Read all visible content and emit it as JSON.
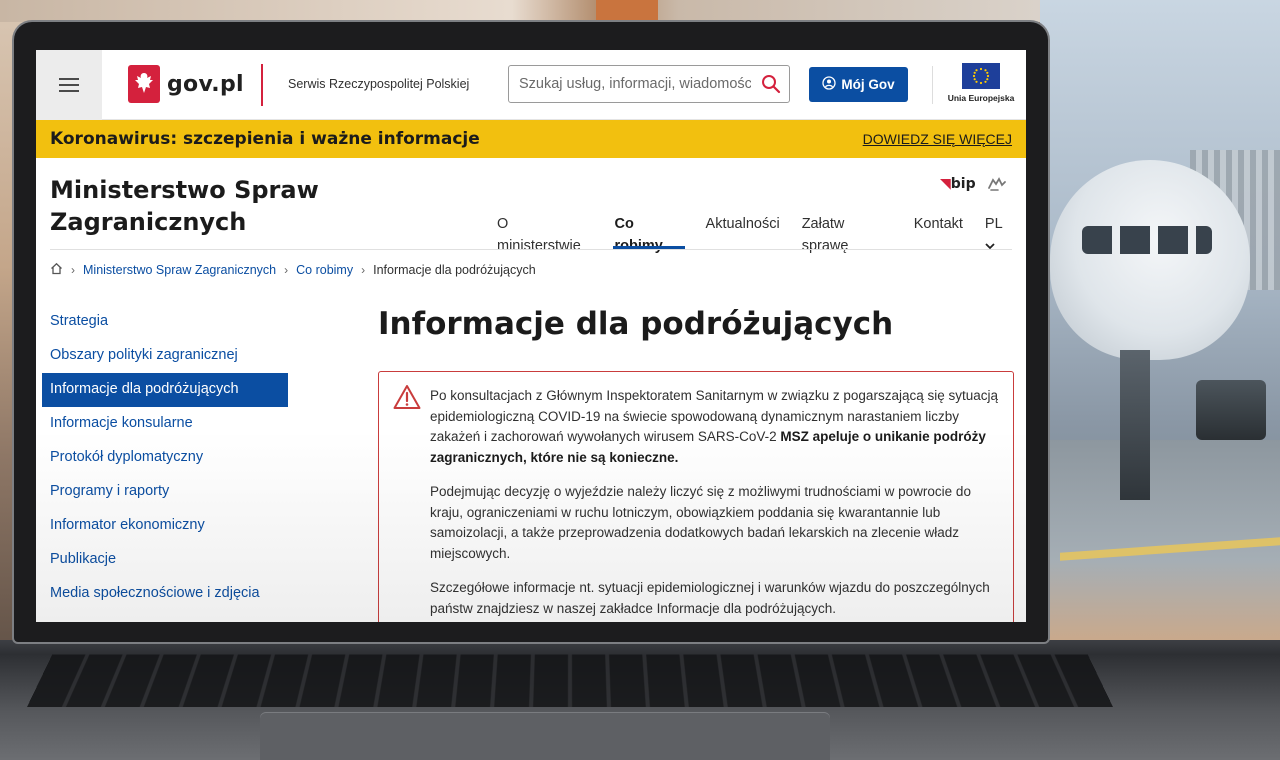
{
  "header": {
    "logo_text": "gov.pl",
    "service_name": "Serwis Rzeczypospolitej Polskiej",
    "search_placeholder": "Szukaj usług, informacji, wiadomości",
    "mojgov_label": "Mój Gov",
    "eu_label": "Unia Europejska"
  },
  "banner": {
    "title": "Koronawirus: szczepienia i ważne informacje",
    "link": "DOWIEDZ SIĘ WIĘCEJ"
  },
  "ministry": {
    "line1": "Ministerstwo Spraw",
    "line2": "Zagranicznych",
    "bip_label": "bip"
  },
  "nav": {
    "items": [
      {
        "label": "O ministerstwie"
      },
      {
        "label": "Co robimy"
      },
      {
        "label": "Aktualności"
      },
      {
        "label": "Załatw sprawę"
      },
      {
        "label": "Kontakt"
      },
      {
        "label": "PL"
      }
    ],
    "active": "Co robimy"
  },
  "breadcrumb": {
    "items": [
      "Ministerstwo Spraw Zagranicznych",
      "Co robimy"
    ],
    "current": "Informacje dla podróżujących"
  },
  "sidebar": {
    "items": [
      {
        "label": "Strategia"
      },
      {
        "label": "Obszary polityki zagranicznej"
      },
      {
        "label": "Informacje dla podróżujących"
      },
      {
        "label": "Informacje konsularne"
      },
      {
        "label": "Protokół dyplomatyczny"
      },
      {
        "label": "Programy i raporty"
      },
      {
        "label": "Informator ekonomiczny"
      },
      {
        "label": "Publikacje"
      },
      {
        "label": "Media społecznościowe i zdjęcia"
      }
    ],
    "active": "Informacje dla podróżujących"
  },
  "main": {
    "title": "Informacje dla podróżujących",
    "alert": {
      "p1_text": "Po konsultacjach z Głównym Inspektoratem Sanitarnym w związku z pogarszającą się sytuacją epidemiologiczną COVID-19 na świecie spowodowaną dynamicznym narastaniem liczby zakażeń i zachorowań wywołanych wirusem SARS-CoV-2 ",
      "p1_bold": "MSZ apeluje o unikanie podróży zagranicznych, które nie są konieczne.",
      "p2": "Podejmując decyzję o wyjeździe należy liczyć się z możliwymi trudnościami w powrocie do kraju, ograniczeniami w ruchu lotniczym, obowiązkiem poddania się kwarantannie lub samoizolacji, a także przeprowadzenia dodatkowych badań lekarskich na zlecenie władz miejscowych.",
      "p3": "Szczegółowe informacje nt. sytuacji epidemiologicznej i warunków wjazdu do poszczególnych państw znajdziesz w naszej zakładce Informacje dla podróżujących."
    }
  },
  "colors": {
    "gov_blue": "#0b4ea2",
    "banner_yellow": "#f2c00f",
    "gov_red": "#d4213d",
    "alert_border": "#c93c3c"
  },
  "icons": [
    "menu-icon",
    "eagle-emblem-icon",
    "search-icon",
    "user-circle-icon",
    "eu-flag-icon",
    "sign-language-icon",
    "home-icon",
    "chevron-right-icon",
    "chevron-down-icon",
    "warning-triangle-icon"
  ]
}
